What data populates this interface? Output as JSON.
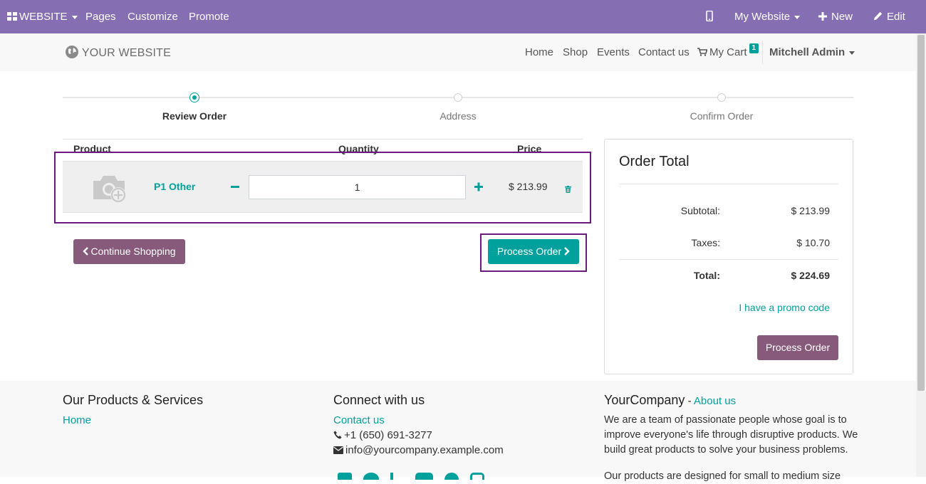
{
  "topbar": {
    "website_label": "WEBSITE",
    "pages": "Pages",
    "customize": "Customize",
    "promote": "Promote",
    "my_website": "My Website",
    "new": "New",
    "edit": "Edit"
  },
  "header": {
    "logo_text": "YOUR WEBSITE",
    "nav": [
      "Home",
      "Shop",
      "Events",
      "Contact us"
    ],
    "cart_label": "My Cart",
    "cart_count": "1",
    "user": "Mitchell Admin"
  },
  "progress": {
    "steps": [
      "Review Order",
      "Address",
      "Confirm Order"
    ],
    "active_index": 0
  },
  "cart": {
    "headers": {
      "product": "Product",
      "quantity": "Quantity",
      "price": "Price"
    },
    "lines": [
      {
        "product": "P1 Other",
        "quantity": "1",
        "price": "$ 213.99"
      }
    ]
  },
  "actions": {
    "continue_shopping": "Continue Shopping",
    "process_order": "Process Order"
  },
  "order_total": {
    "title": "Order Total",
    "subtotal_label": "Subtotal:",
    "subtotal_value": "$ 213.99",
    "taxes_label": "Taxes:",
    "taxes_value": "$ 10.70",
    "total_label": "Total:",
    "total_value": "$ 224.69",
    "promo_link": "I have a promo code",
    "process_button": "Process Order"
  },
  "footer": {
    "products_title": "Our Products & Services",
    "products_link": "Home",
    "connect_title": "Connect with us",
    "contact_link": "Contact us",
    "phone": "+1 (650) 691-3277",
    "email": "info@yourcompany.example.com",
    "company_name": "YourCompany",
    "company_sep": " - ",
    "about_link": "About us",
    "about_text": "We are a team of passionate people whose goal is to improve everyone's life through disruptive products. We build great products to solve your business problems.",
    "about_text2": "Our products are designed for small to medium size"
  },
  "colors": {
    "topbar": "#856eb1",
    "accent": "#00a09d",
    "secondary_button": "#875a7b",
    "highlight_border": "#6d1a7e"
  }
}
